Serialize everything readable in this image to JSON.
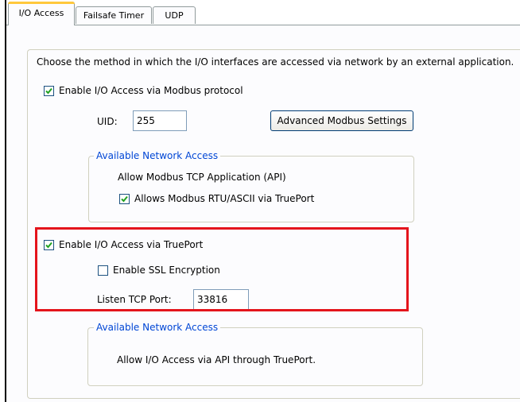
{
  "tabs": [
    "I/O Access",
    "Failsafe Timer",
    "UDP"
  ],
  "intro_text": "Choose the method in which the I/O interfaces are accessed via network by an external application.",
  "modbus": {
    "enable_label": "Enable I/O Access via Modbus protocol",
    "enabled": true,
    "uid_label": "UID:",
    "uid_value": "255",
    "advanced_button": "Advanced Modbus Settings",
    "group_title": "Available Network Access",
    "api_text": "Allow Modbus TCP Application (API)",
    "rtu_label": "Allows Modbus RTU/ASCII via TruePort",
    "rtu_checked": true
  },
  "trueport": {
    "enable_label": "Enable I/O Access via TruePort",
    "enabled": true,
    "ssl_label": "Enable SSL Encryption",
    "ssl_checked": false,
    "port_label": "Listen TCP Port:",
    "port_value": "33816",
    "group_title": "Available Network Access",
    "api_text": "Allow I/O Access via API through TruePort."
  },
  "colors": {
    "highlight": "#e4141c",
    "legend": "#0046d5",
    "check": "#21a121"
  }
}
